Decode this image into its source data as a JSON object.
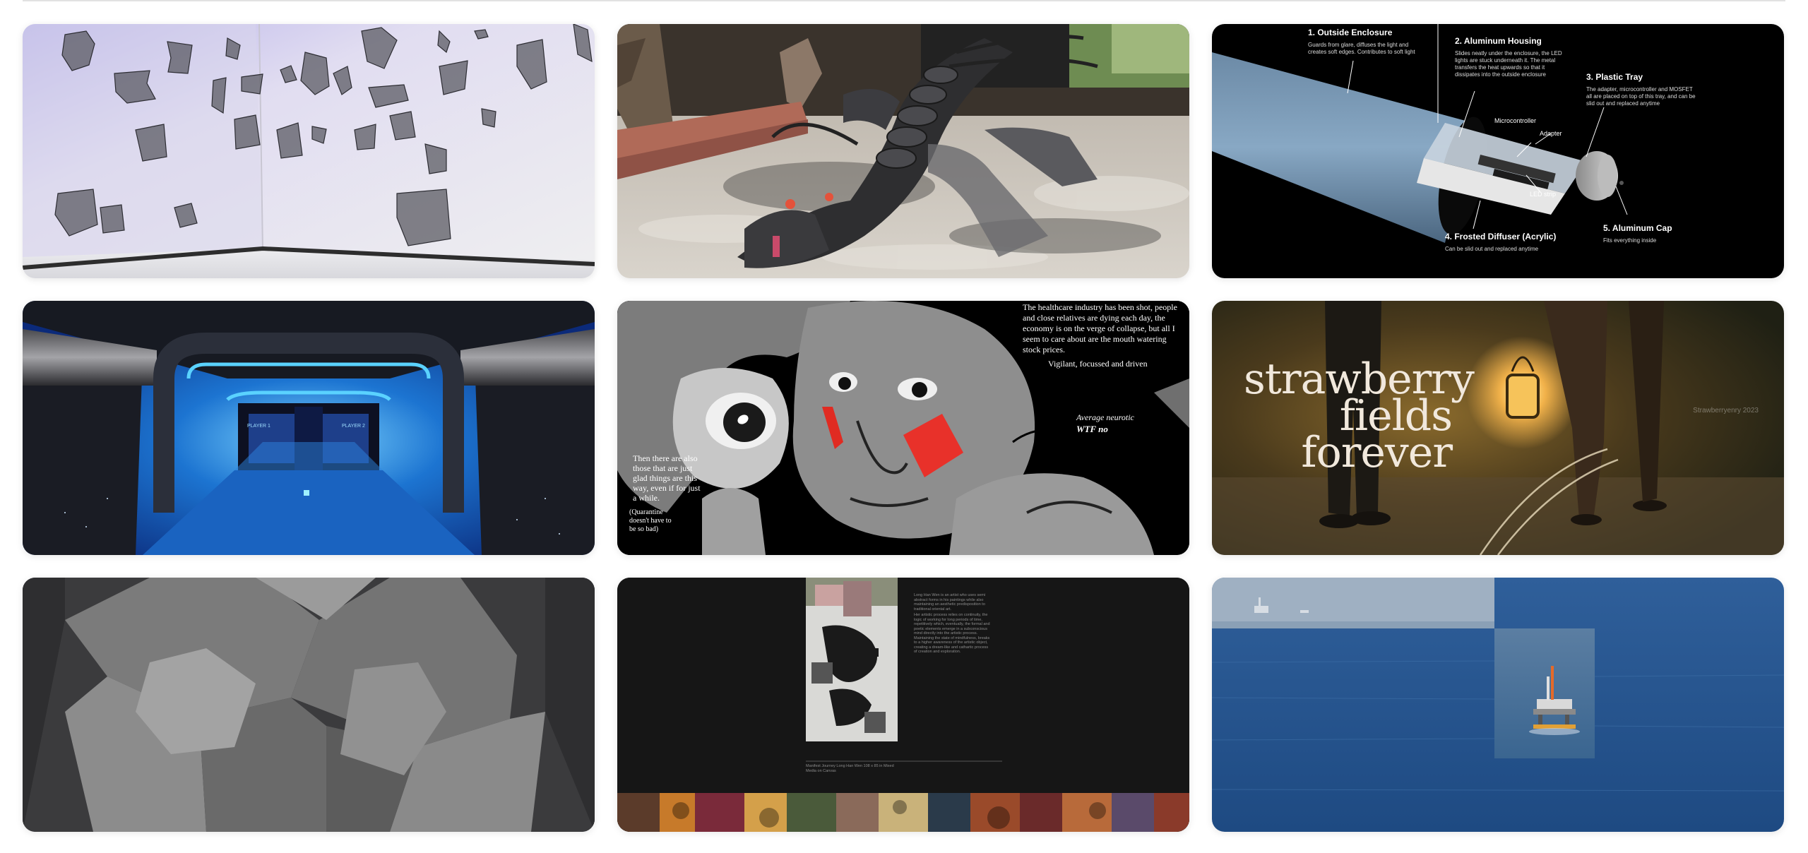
{
  "cards": [
    {
      "name": "paper-sculpture-wall"
    },
    {
      "name": "dragon-sculpture"
    },
    {
      "name": "lamp-diagram",
      "labels": {
        "outside_enclosure": {
          "title": "1. Outside Enclosure",
          "desc": "Guards from glare, diffuses the light and creates soft edges. Contributes to soft light"
        },
        "aluminum_housing": {
          "title": "2. Aluminum Housing",
          "desc": "Slides neatly under the enclosure, the LED lights are stuck underneath it. The metal transfers the heat upwards so that it dissipates into the outside enclosure"
        },
        "plastic_tray": {
          "title": "3. Plastic Tray",
          "desc": "The adapter, microcontroller and MOSFET all are placed on top of this tray, and can be slid out and replaced anytime"
        },
        "frosted_diffuser": {
          "title": "4. Frosted Diffuser (Acrylic)",
          "desc": "Can be slid out and replaced anytime"
        },
        "aluminum_cap": {
          "title": "5. Aluminum Cap",
          "desc": "Fits everything inside"
        },
        "microcontroller": "Microcontroller",
        "adapter": "Adapter",
        "led_strip": "LED strip"
      }
    },
    {
      "name": "sci-fi-corridor",
      "player1": "PLAYER 1",
      "player2": "PLAYER 2"
    },
    {
      "name": "healthcare-illustration",
      "text_block_1": "The healthcare industry has been shot, people and close relatives are dying each day, the economy is on the verge of collapse, but all I seem to care about are the mouth watering stock prices.",
      "text_block_2": "Vigilant, focussed and driven",
      "text_block_3": "Average neurotic",
      "text_block_4": "WTF no",
      "text_block_5": "Then there are also those that are just glad things are this way, even if for just a while.",
      "text_block_6": "(Quarantine doesn't have to be so bad)"
    },
    {
      "name": "strawberry-fields",
      "title_lines": [
        "strawberry",
        "fields",
        "forever"
      ],
      "watermark": "Strawberryenry 2023"
    },
    {
      "name": "dodecahedron-render"
    },
    {
      "name": "long-han-wen-page",
      "para1": "Long Han Wen is an artist who uses semi abstract forms in his paintings while also maintaining an aesthetic predisposition to traditional oriental art.",
      "para2": "Her artistic process relies on continuity, the logic of working for long periods of time, repetitively which, eventually, the formal and poetic elements emerge in a subconscious mind directly into the artistic process. Maintaining the state of mindfulness, breaks to a higher awareness of the artistic object, creating a dream-like and cathartic process of creation and exploration.",
      "caption": "Manifest Journey  Long Han Wen  108 x 85 in  Mixed",
      "caption2": "Media on Canvas"
    },
    {
      "name": "ocean-oil-rig"
    }
  ]
}
